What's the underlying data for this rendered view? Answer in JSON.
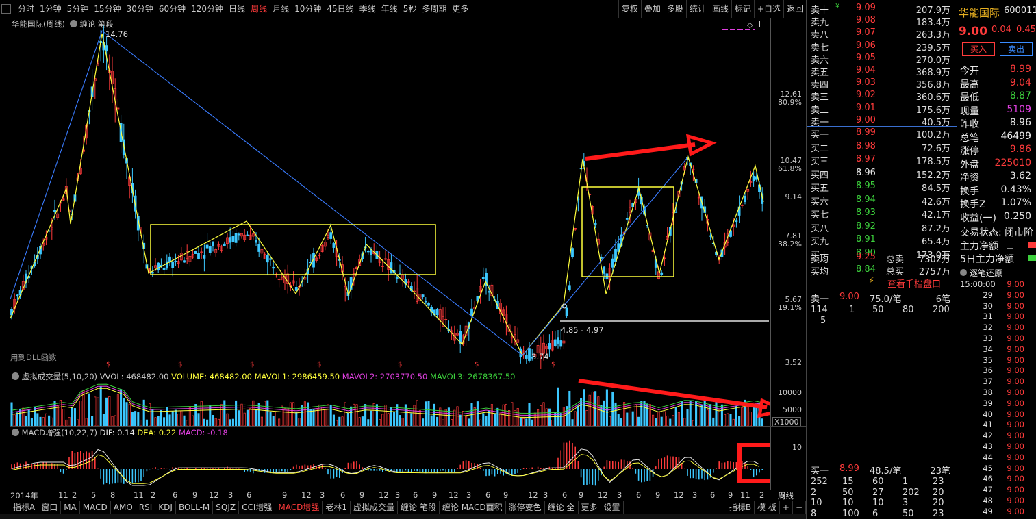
{
  "toolbar": {
    "periods": [
      "分时",
      "1分钟",
      "5分钟",
      "15分钟",
      "30分钟",
      "60分钟",
      "120分钟",
      "日线",
      "周线",
      "月线",
      "10分钟",
      "45日线",
      "季线",
      "年线",
      "5秒",
      "多周期",
      "更多"
    ],
    "active_period": "周线",
    "right_buttons": [
      "复权",
      "叠加",
      "多股",
      "统计",
      "画线",
      "标记",
      "+自选",
      "返回"
    ]
  },
  "chart_header": {
    "title": "华能国际(周线)",
    "indicator": "缠论 笔段",
    "high_label": "14.76",
    "low_label": "3.74",
    "range_label": "4.85 - 4.97",
    "dll_note": "用到DLL函数"
  },
  "price_axis": [
    {
      "value": "12.61",
      "pct": "80.9%"
    },
    {
      "value": "10.47",
      "pct": "61.8%"
    },
    {
      "value": "9.14",
      "pct": ""
    },
    {
      "value": "7.81",
      "pct": "38.2%"
    },
    {
      "value": "5.67",
      "pct": "19.1%"
    },
    {
      "value": "3.52",
      "pct": ""
    }
  ],
  "volume_panel": {
    "title": "虚拟成交量(5,10,20)",
    "vvol": "VVOL: 468482.00",
    "volume": "VOLUME: 468482.00",
    "mavol1": "MAVOL1: 2986459.50",
    "mavol2": "MAVOL2: 2703770.50",
    "mavol3": "MAVOL3: 2678367.50",
    "axis": [
      "10000",
      "5000",
      "X1000"
    ]
  },
  "macd_panel": {
    "title": "MACD增强(10,22,7)",
    "dif": "DIF: 0.14",
    "dea": "DEA: 0.22",
    "macd": "MACD: -0.18",
    "axis_top": "10"
  },
  "x_axis": {
    "labels": [
      "2014年",
      "11",
      "2",
      "5",
      "8",
      "11",
      "2",
      "6",
      "9",
      "12",
      "3",
      "6",
      "9",
      "12",
      "3",
      "6",
      "9",
      "12",
      "3",
      "6",
      "9",
      "12",
      "3",
      "6",
      "9",
      "12",
      "3",
      "6",
      "9",
      "12",
      "3",
      "6",
      "9",
      "12",
      "3",
      "6",
      "9",
      "11",
      "2",
      "5"
    ],
    "period_label": "周线"
  },
  "bottom_tabs": [
    "指标A",
    "窗口",
    "MA",
    "MACD",
    "AMO",
    "RSI",
    "KDJ",
    "BOLL-M",
    "SQJZ",
    "CCI增强",
    "MACD增强",
    "老林1",
    "虚拟成交量",
    "缠论 笔段",
    "缠论 MACD面积",
    "涨停变色",
    "缠论 全",
    "更多",
    "设置"
  ],
  "bottom_tab_active": "MACD增强",
  "bottom_right": [
    "指标B",
    "模 板",
    "+",
    "−"
  ],
  "order_book": {
    "asks": [
      {
        "label": "卖十",
        "flag": "¥",
        "price": "9.09",
        "vol": "207.9万"
      },
      {
        "label": "卖九",
        "flag": "",
        "price": "9.08",
        "vol": "183.4万"
      },
      {
        "label": "卖八",
        "flag": "",
        "price": "9.07",
        "vol": "263.3万"
      },
      {
        "label": "卖七",
        "flag": "",
        "price": "9.06",
        "vol": "239.5万"
      },
      {
        "label": "卖六",
        "flag": "",
        "price": "9.05",
        "vol": "270.0万"
      },
      {
        "label": "卖五",
        "flag": "",
        "price": "9.04",
        "vol": "368.9万"
      },
      {
        "label": "卖四",
        "flag": "",
        "price": "9.03",
        "vol": "356.8万"
      },
      {
        "label": "卖三",
        "flag": "",
        "price": "9.02",
        "vol": "360.6万"
      },
      {
        "label": "卖二",
        "flag": "",
        "price": "9.01",
        "vol": "175.6万"
      },
      {
        "label": "卖一",
        "flag": "",
        "price": "9.00",
        "vol": "40.5万"
      }
    ],
    "bids": [
      {
        "label": "买一",
        "price": "8.99",
        "vol": "100.2万",
        "color": "red"
      },
      {
        "label": "买二",
        "price": "8.98",
        "vol": "72.6万",
        "color": "red"
      },
      {
        "label": "买三",
        "price": "8.97",
        "vol": "178.5万",
        "color": "red"
      },
      {
        "label": "买四",
        "price": "8.96",
        "vol": "152.2万",
        "color": "white"
      },
      {
        "label": "买五",
        "price": "8.95",
        "vol": "84.5万",
        "color": "green"
      },
      {
        "label": "买六",
        "price": "8.94",
        "vol": "42.6万",
        "color": "green"
      },
      {
        "label": "买七",
        "price": "8.93",
        "vol": "42.1万",
        "color": "green"
      },
      {
        "label": "买八",
        "price": "8.92",
        "vol": "87.2万",
        "color": "green"
      },
      {
        "label": "买九",
        "price": "8.91",
        "vol": "65.4万",
        "color": "green"
      },
      {
        "label": "买十",
        "price": "8.90",
        "vol": "173.0万",
        "color": "green"
      }
    ],
    "sell_avg": {
      "label": "卖均",
      "price": "9.25",
      "name": "总卖",
      "vol": "7302万"
    },
    "buy_avg": {
      "label": "买均",
      "price": "8.84",
      "name": "总买",
      "vol": "2757万"
    },
    "thousand_link": "查看千档盘口",
    "ask1_detail": {
      "label": "卖一",
      "price": "9.00",
      "per": "75.0/笔",
      "count": "6笔",
      "queue": [
        "114",
        "1",
        "50",
        "80",
        "200"
      ],
      "queue2": "5"
    },
    "bid1_detail": {
      "label": "买一",
      "price": "8.99",
      "per": "48.5/笔",
      "count": "23笔",
      "rows": [
        [
          "252",
          "15",
          "60",
          "1",
          "23"
        ],
        [
          "2",
          "50",
          "27",
          "202",
          "20"
        ],
        [
          "10",
          "10",
          "10",
          "3",
          "20"
        ],
        [
          "8",
          "100",
          "6",
          "50",
          "23"
        ]
      ]
    }
  },
  "quote": {
    "name": "华能国际",
    "code": "600011",
    "price": "9.00",
    "change": "0.04",
    "pct": "0.45",
    "buy_btn": "买入",
    "sell_btn": "卖出",
    "fields": [
      {
        "k": "今开",
        "v": "8.99",
        "c": "red"
      },
      {
        "k": "最高",
        "v": "9.04",
        "c": "red"
      },
      {
        "k": "最低",
        "v": "8.87",
        "c": "green"
      },
      {
        "k": "现量",
        "v": "5109",
        "c": "magenta"
      },
      {
        "k": "昨收",
        "v": "8.96",
        "c": "white"
      },
      {
        "k": "总笔",
        "v": "46499",
        "c": "white"
      },
      {
        "k": "涨停",
        "v": "9.86",
        "c": "red"
      },
      {
        "k": "外盘",
        "v": "225010",
        "c": "red"
      },
      {
        "k": "净资",
        "v": "3.62",
        "c": "white"
      },
      {
        "k": "换手",
        "v": "0.43%",
        "c": "white"
      },
      {
        "k": "换手Z",
        "v": "1.07%",
        "c": "white"
      },
      {
        "k": "收益(一)",
        "v": "0.250",
        "c": "white"
      }
    ],
    "trade_state": "交易状态: 闭市阶",
    "main_net": "主力净额",
    "main_net5": "5日主力净额",
    "ticks_title": "逐笔还原",
    "ticks": [
      {
        "t": "15:00:00",
        "p": "9.00"
      },
      {
        "t": "29",
        "p": "9.00"
      },
      {
        "t": "30",
        "p": "9.00"
      },
      {
        "t": "31",
        "p": "9.00"
      },
      {
        "t": "32",
        "p": "9.00"
      },
      {
        "t": "33",
        "p": "9.00"
      },
      {
        "t": "34",
        "p": "9.00"
      },
      {
        "t": "35",
        "p": "9.00"
      },
      {
        "t": "36",
        "p": "9.00"
      },
      {
        "t": "37",
        "p": "9.00"
      },
      {
        "t": "38",
        "p": "9.00"
      },
      {
        "t": "39",
        "p": "9.00"
      },
      {
        "t": "40",
        "p": "9.00"
      },
      {
        "t": "41",
        "p": "9.00"
      },
      {
        "t": "42",
        "p": "9.00"
      },
      {
        "t": "43",
        "p": "9.00"
      },
      {
        "t": "44",
        "p": "9.00"
      },
      {
        "t": "45",
        "p": "9.00"
      },
      {
        "t": "46",
        "p": "9.00"
      },
      {
        "t": "47",
        "p": "9.00"
      },
      {
        "t": "48",
        "p": "9.00"
      },
      {
        "t": "49",
        "p": "9.00"
      }
    ]
  }
}
